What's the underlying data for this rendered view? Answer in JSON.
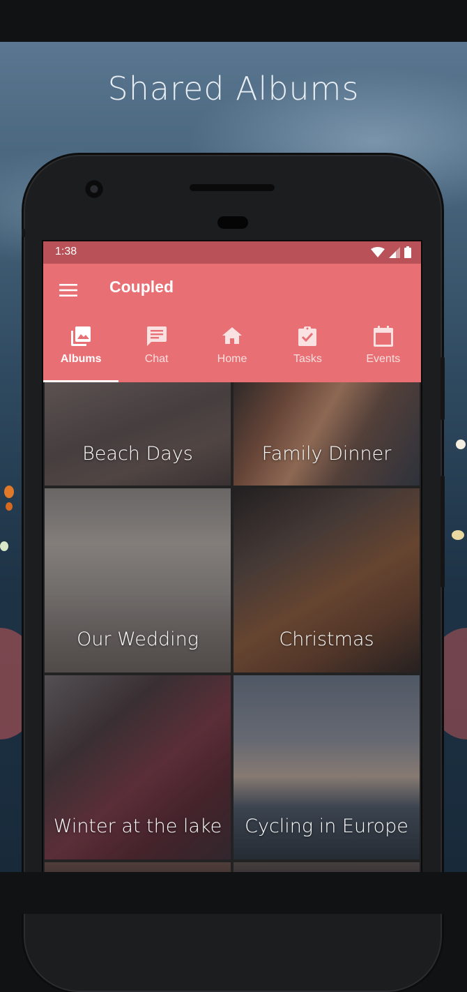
{
  "backdrop": {
    "heading": "Shared Albums"
  },
  "statusbar": {
    "time": "1:38",
    "icons": [
      "wifi-icon",
      "signal-icon",
      "battery-icon"
    ]
  },
  "appbar": {
    "title": "Coupled",
    "menu_icon": "menu-icon"
  },
  "tabs": [
    {
      "label": "Albums",
      "icon": "photo-library-icon",
      "active": true
    },
    {
      "label": "Chat",
      "icon": "chat-icon",
      "active": false
    },
    {
      "label": "Home",
      "icon": "home-icon",
      "active": false
    },
    {
      "label": "Tasks",
      "icon": "assignment-check-icon",
      "active": false
    },
    {
      "label": "Events",
      "icon": "calendar-icon",
      "active": false
    }
  ],
  "albums": [
    {
      "title": "Beach Days"
    },
    {
      "title": "Family Dinner"
    },
    {
      "title": "Our Wedding"
    },
    {
      "title": "Christmas"
    },
    {
      "title": "Winter at the lake"
    },
    {
      "title": "Cycling in Europe"
    }
  ],
  "colors": {
    "accent": "#e86f73",
    "statusbar": "#b95258",
    "text_on_accent": "#ffffff"
  }
}
